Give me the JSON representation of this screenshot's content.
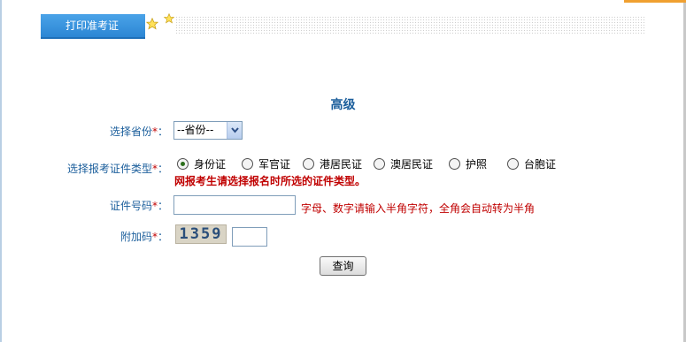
{
  "tab": {
    "label": "打印准考证"
  },
  "page_title": "高级",
  "form": {
    "required_mark": "*",
    "province": {
      "label": "选择省份",
      "selected": "--省份--"
    },
    "id_type": {
      "label": "选择报考证件类型",
      "options": [
        "身份证",
        "军官证",
        "港居民证",
        "澳居民证",
        "护照",
        "台胞证"
      ],
      "selected_index": 0,
      "warning": "网报考生请选择报名时所选的证件类型。"
    },
    "id_number": {
      "label": "证件号码",
      "value": "",
      "hint": "字母、数字请输入半角字符，全角会自动转为半角"
    },
    "captcha": {
      "label": "附加码",
      "code": "1359",
      "value": ""
    },
    "submit_label": "查询"
  }
}
